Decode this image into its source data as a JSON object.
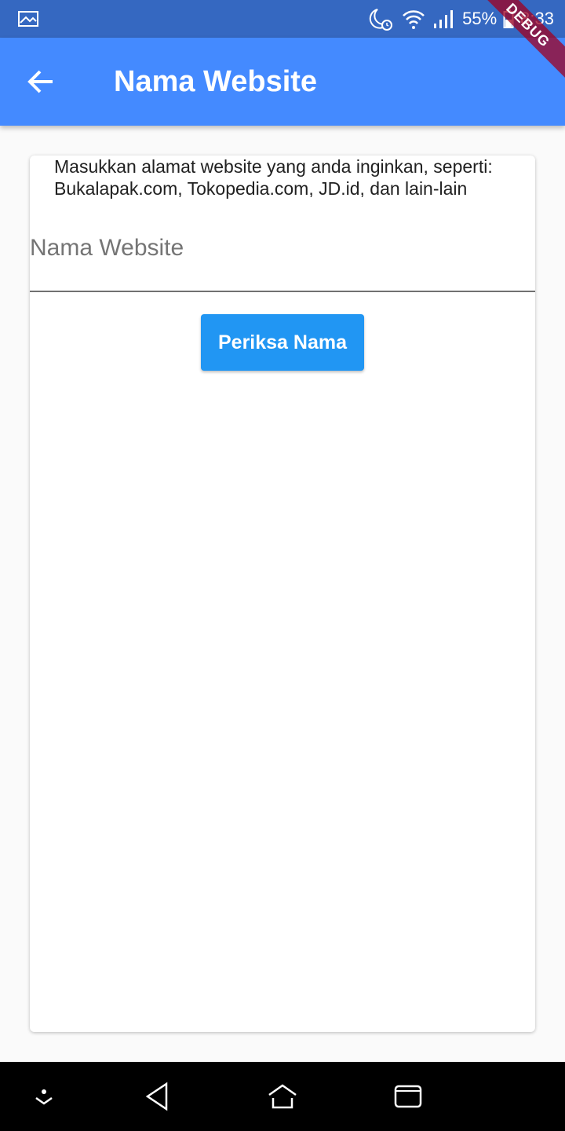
{
  "status_bar": {
    "battery": "55%",
    "time": "8:33",
    "icons": [
      "image-icon",
      "moon-alarm-icon",
      "wifi-icon",
      "signal-icon",
      "battery-icon"
    ]
  },
  "app_bar": {
    "title": "Nama Website",
    "back_icon": "arrow-back-icon",
    "color": "#448aff"
  },
  "debug_banner": "DEBUG",
  "form": {
    "description": "Masukkan alamat website yang anda inginkan, seperti: Bukalapak.com, Tokopedia.com, JD.id, dan lain-lain",
    "input_value": "",
    "input_placeholder": "Nama Website",
    "button_label": "Periksa Nama",
    "button_color": "#2196f3"
  },
  "nav_bar": {
    "icons": [
      "chevron-down-icon",
      "back-triangle-icon",
      "home-icon",
      "recents-icon"
    ]
  }
}
